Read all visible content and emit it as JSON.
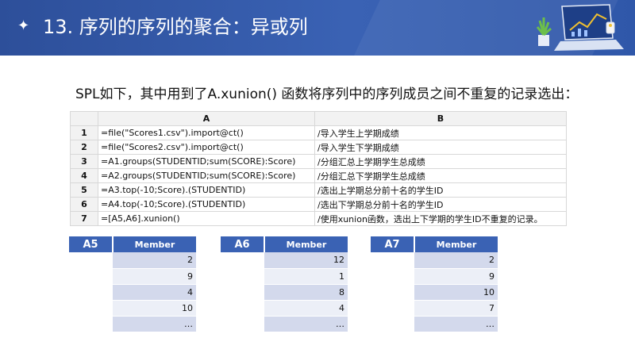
{
  "header": {
    "star": "✦",
    "title": "13. 序列的序列的聚合：异或列"
  },
  "intro": "SPL如下，其中用到了A.xunion() 函数将序列中的序列成员之间不重复的记录选出：",
  "table": {
    "columns": [
      "A",
      "B"
    ],
    "rows": [
      {
        "num": "1",
        "code": "=file(\"Scores1.csv\").import@ct()",
        "comment": "/导入学生上学期成绩"
      },
      {
        "num": "2",
        "code": "=file(\"Scores2.csv\").import@ct()",
        "comment": "/导入学生下学期成绩"
      },
      {
        "num": "3",
        "code": "=A1.groups(STUDENTID;sum(SCORE):Score)",
        "comment": "/分组汇总上学期学生总成绩"
      },
      {
        "num": "4",
        "code": "=A2.groups(STUDENTID;sum(SCORE):Score)",
        "comment": "/分组汇总下学期学生总成绩"
      },
      {
        "num": "5",
        "code": "=A3.top(-10;Score).(STUDENTID)",
        "comment": "/选出上学期总分前十名的学生ID"
      },
      {
        "num": "6",
        "code": "=A4.top(-10;Score).(STUDENTID)",
        "comment": "/选出下学期总分前十名的学生ID"
      },
      {
        "num": "7",
        "code": "=[A5,A6].xunion()",
        "comment": "/使用xunion函数，选出上下学期的学生ID不重复的记录。"
      }
    ]
  },
  "results": [
    {
      "label": "A5",
      "header": "Member",
      "values": [
        "2",
        "9",
        "4",
        "10",
        "…"
      ]
    },
    {
      "label": "A6",
      "header": "Member",
      "values": [
        "12",
        "1",
        "8",
        "4",
        "…"
      ]
    },
    {
      "label": "A7",
      "header": "Member",
      "values": [
        "2",
        "9",
        "10",
        "7",
        "…"
      ]
    }
  ],
  "colors": {
    "header_blue": "#3a62b4",
    "row_dark": "#d3d9ec",
    "row_light": "#eceff7"
  }
}
